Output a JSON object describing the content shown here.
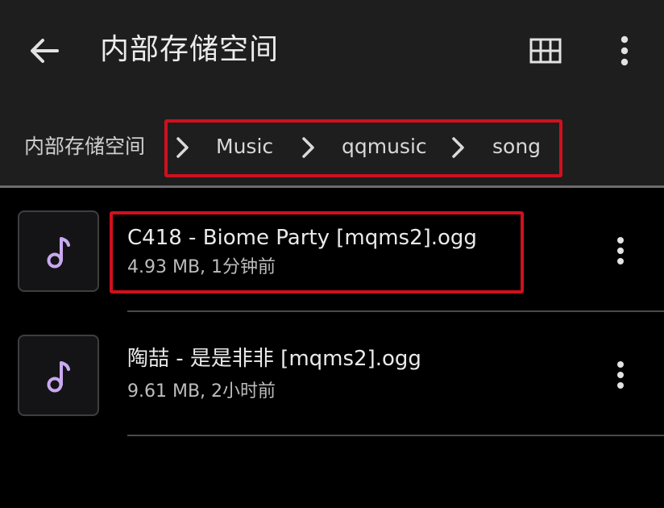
{
  "appbar": {
    "title": "内部存储空间",
    "back_icon": "arrow-left-icon",
    "grid_icon": "grid-view-icon",
    "more_icon": "more-vert-icon"
  },
  "breadcrumb": {
    "root": "内部存储空间",
    "separator_icon": "chevron-right-icon",
    "items": [
      {
        "label": "Music"
      },
      {
        "label": "qqmusic"
      },
      {
        "label": "song"
      }
    ]
  },
  "files": [
    {
      "name": "C418 - Biome Party [mqms2].ogg",
      "meta": "4.93 MB, 1分钟前",
      "icon": "music-note-icon"
    },
    {
      "name": "陶喆 - 是是非非 [mqms2].ogg",
      "meta": "9.61 MB, 2小时前",
      "icon": "music-note-icon"
    }
  ],
  "colors": {
    "highlight": "#d0101e",
    "bar_background": "#1e1e1e",
    "list_background": "#000000",
    "music_icon": "#c9a9f0"
  }
}
